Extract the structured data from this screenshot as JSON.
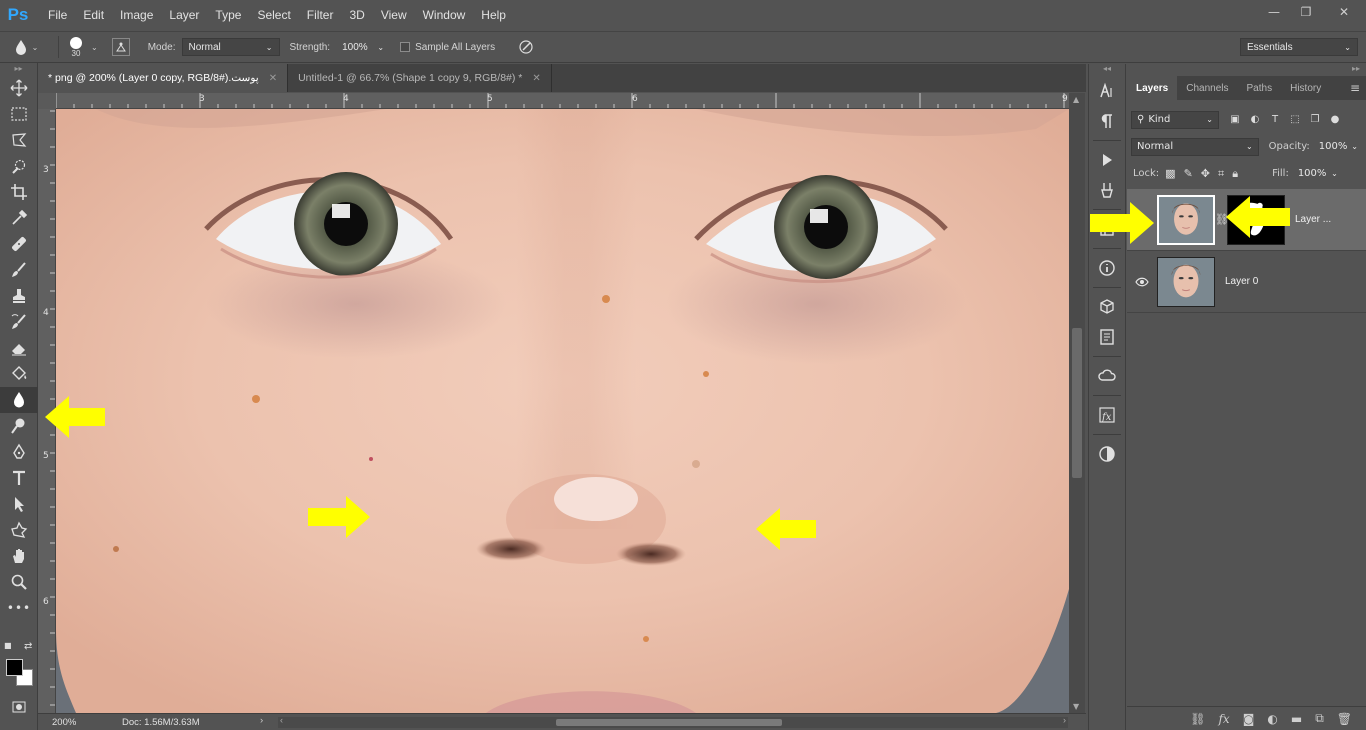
{
  "app": {
    "logo": "Ps"
  },
  "menu": [
    "File",
    "Edit",
    "Image",
    "Layer",
    "Type",
    "Select",
    "Filter",
    "3D",
    "View",
    "Window",
    "Help"
  ],
  "window_controls": {
    "minimize": "—",
    "restore": "❐",
    "close": "✕"
  },
  "options": {
    "brush_size": "30",
    "mode_label": "Mode:",
    "mode_value": "Normal",
    "strength_label": "Strength:",
    "strength_value": "100%",
    "sample_all_layers": "Sample All Layers",
    "workspace": "Essentials"
  },
  "tabs": [
    {
      "title": "پوست.png @ 200% (Layer 0 copy, RGB/8#) *",
      "active": true
    },
    {
      "title": "Untitled-1 @ 66.7% (Shape 1 copy 9, RGB/8#) *",
      "active": false
    }
  ],
  "ruler": {
    "h": [
      "3",
      "4",
      "5",
      "6",
      "9"
    ],
    "v": [
      "3",
      "4",
      "5",
      "6"
    ]
  },
  "status": {
    "zoom": "200%",
    "doc": "Doc: 1.56M/3.63M"
  },
  "layers_panel": {
    "tabs": [
      "Layers",
      "Channels",
      "Paths",
      "History"
    ],
    "kind": "Kind",
    "blend_mode": "Normal",
    "opacity_label": "Opacity:",
    "opacity": "100%",
    "lock_label": "Lock:",
    "fill_label": "Fill:",
    "fill": "100%",
    "layers": [
      {
        "name": "Layer ...",
        "selected": true,
        "has_mask": true,
        "visible": false
      },
      {
        "name": "Layer 0",
        "selected": false,
        "has_mask": false,
        "visible": true
      }
    ]
  },
  "colors": {
    "accent": "#31a8ff",
    "arrow": "#ffff00",
    "panel": "#535353"
  }
}
